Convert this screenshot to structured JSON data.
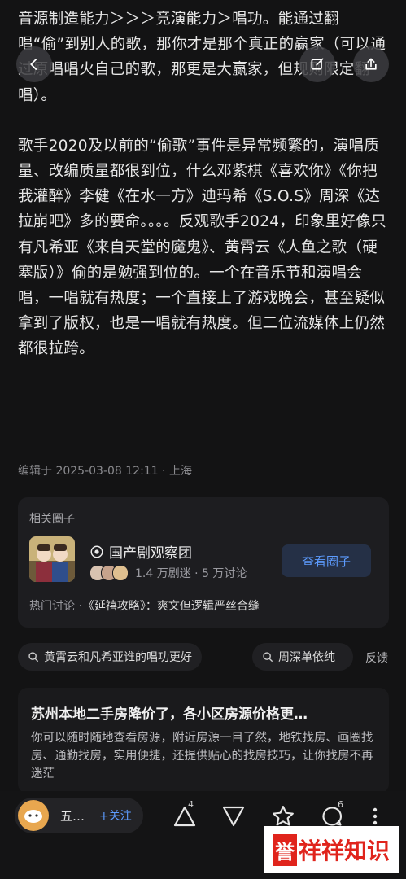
{
  "article": {
    "paragraphs": [
      "音源制造能力＞＞＞竞演能力＞唱功。能通过翻唱“偷”到别人的歌，那你才是那个真正的赢家（可以通过原唱唱火自己的歌，那更是大赢家，但规则限定翻唱）。",
      "歌手2020及以前的“偷歌”事件是异常频繁的，演唱质量、改编质量都很到位，什么邓紫棋《喜欢你》《你把我灌醉》李健《在水一方》迪玛希《S.O.S》周深《达拉崩吧》多的要命。。。。反观歌手2024，印象里好像只有凡希亚《来自天堂的魔鬼》、黄霄云《人鱼之歌（硬塞版）》偷的是勉强到位的。一个在音乐节和演唱会唱，一唱就有热度；一个直接上了游戏晚会，甚至疑似拿到了版权，也是一唱就有热度。但二位流媒体上仍然都很拉跨。"
    ],
    "meta": "编辑于 2025-03-08 12:11 · 上海"
  },
  "nav": {
    "back_icon": "chevron-left-icon",
    "edit_icon": "edit-icon",
    "share_icon": "share-icon"
  },
  "circle": {
    "header": "相关圈子",
    "name": "国产剧观察团",
    "stats": "1.4 万剧迷 · 5 万讨论",
    "button": "查看圈子",
    "hot_label": "热门讨论 ·",
    "hot_topic": "《延禧攻略》：爽文但逻辑严丝合缝"
  },
  "search_chips": [
    "黄霄云和凡希亚谁的唱功更好",
    "周深单依纯"
  ],
  "feedback": "反馈",
  "ad": {
    "title": "苏州本地二手房降价了，各小区房源价格更…",
    "body": "你可以随时随地查看房源，附近房源一目了然，地铁找房、画圈找房、通勤找房，实用便捷，还提供贴心的找房技巧，让你找房不再迷茫"
  },
  "bottom": {
    "author_name": "五…",
    "follow": "+关注",
    "upvote_count": "4",
    "comment_count": "6"
  },
  "watermark": {
    "box": "誉",
    "text": "祥祥知识"
  },
  "colors": {
    "background": "#131314",
    "accent": "#5d9cff",
    "watermark_red": "#e0241c"
  }
}
